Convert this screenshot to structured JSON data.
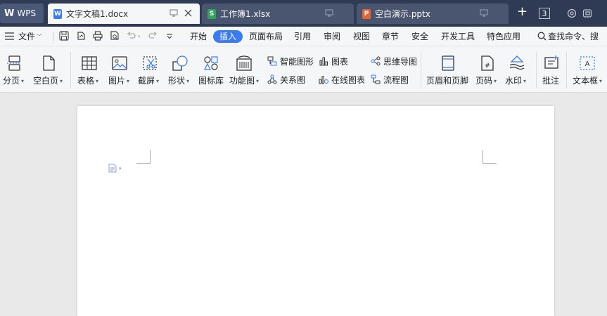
{
  "titlebar": {
    "app_name": "WPS",
    "tabs": [
      {
        "name": "文字文稿1.docx",
        "type": "W",
        "color": "#3a7cf0",
        "active": true
      },
      {
        "name": "工作簿1.xlsx",
        "type": "S",
        "color": "#2fa55b",
        "active": false
      },
      {
        "name": "空白演示.pptx",
        "type": "P",
        "color": "#e8632f",
        "active": false
      }
    ],
    "window_count": "3"
  },
  "menubar": {
    "file_label": "文件",
    "items": [
      "开始",
      "插入",
      "页面布局",
      "引用",
      "审阅",
      "视图",
      "章节",
      "安全",
      "开发工具",
      "特色应用"
    ],
    "active_item": "插入",
    "search_label": "查找命令、搜"
  },
  "ribbon": {
    "big_buttons": [
      {
        "label": "分页",
        "icon": "page-break-icon",
        "dropdown": true
      },
      {
        "label": "空白页",
        "icon": "blank-page-icon",
        "dropdown": true
      },
      {
        "label": "表格",
        "icon": "table-icon",
        "dropdown": true
      },
      {
        "label": "图片",
        "icon": "picture-icon",
        "dropdown": true
      },
      {
        "label": "截屏",
        "icon": "screenshot-icon",
        "dropdown": true
      },
      {
        "label": "形状",
        "icon": "shapes-icon",
        "dropdown": true
      },
      {
        "label": "图标库",
        "icon": "icon-library-icon",
        "dropdown": false
      },
      {
        "label": "功能图",
        "icon": "function-chart-icon",
        "dropdown": true
      },
      {
        "label": "页眉和页脚",
        "icon": "header-footer-icon",
        "dropdown": false
      },
      {
        "label": "页码",
        "icon": "page-number-icon",
        "dropdown": true
      },
      {
        "label": "水印",
        "icon": "watermark-icon",
        "dropdown": true
      },
      {
        "label": "批注",
        "icon": "comment-icon",
        "dropdown": false
      },
      {
        "label": "文本框",
        "icon": "textbox-icon",
        "dropdown": true
      }
    ],
    "small_buttons": [
      {
        "label": "智能图形",
        "icon": "smartart-icon"
      },
      {
        "label": "关系图",
        "icon": "relation-chart-icon"
      },
      {
        "label": "图表",
        "icon": "chart-icon"
      },
      {
        "label": "在线图表",
        "icon": "online-chart-icon"
      },
      {
        "label": "思维导图",
        "icon": "mindmap-icon"
      },
      {
        "label": "流程图",
        "icon": "flowchart-icon"
      }
    ]
  },
  "colors": {
    "titlebar_bg": "#2f3b55",
    "accent": "#3a7cf0",
    "ribbon_bg": "#f5f6f8",
    "canvas_bg": "#e9e9e9"
  }
}
